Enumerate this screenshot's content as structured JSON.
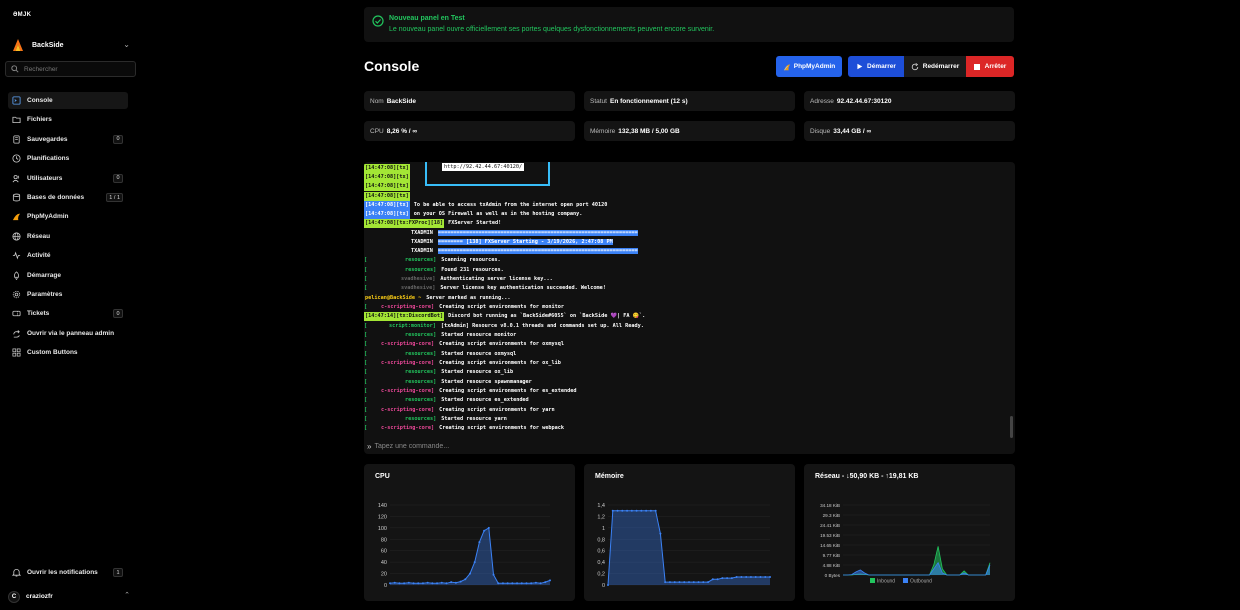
{
  "brand": {
    "logo_text": "ƏMJK"
  },
  "server_selector": {
    "name": "BackSide"
  },
  "search": {
    "placeholder": "Rechercher"
  },
  "nav": [
    {
      "label": "Console",
      "icon": "terminal-icon",
      "badge": ""
    },
    {
      "label": "Fichiers",
      "icon": "folder-icon",
      "badge": ""
    },
    {
      "label": "Sauvegardes",
      "icon": "archive-icon",
      "badge": "0"
    },
    {
      "label": "Planifications",
      "icon": "clock-icon",
      "badge": ""
    },
    {
      "label": "Utilisateurs",
      "icon": "users-icon",
      "badge": "0"
    },
    {
      "label": "Bases de données",
      "icon": "database-icon",
      "badge": "1 / 1"
    },
    {
      "label": "PhpMyAdmin",
      "icon": "phpmyadmin-icon",
      "badge": ""
    },
    {
      "label": "Réseau",
      "icon": "network-icon",
      "badge": ""
    },
    {
      "label": "Activité",
      "icon": "activity-icon",
      "badge": ""
    },
    {
      "label": "Démarrage",
      "icon": "rocket-icon",
      "badge": ""
    },
    {
      "label": "Paramètres",
      "icon": "gear-icon",
      "badge": ""
    },
    {
      "label": "Tickets",
      "icon": "ticket-icon",
      "badge": "0"
    },
    {
      "label": "Ouvrir via le panneau admin",
      "icon": "external-link-icon",
      "badge": ""
    },
    {
      "label": "Custom Buttons",
      "icon": "grid-icon",
      "badge": ""
    }
  ],
  "notifications": {
    "label": "Ouvrir les notifications",
    "badge": "1"
  },
  "user": {
    "initial": "C",
    "name": "craziozfr"
  },
  "banner": {
    "title": "Nouveau panel en Test",
    "message": "Le nouveau panel ouvre officiellement ses portes quelques dysfonctionnements peuvent encore survenir."
  },
  "page": {
    "title": "Console"
  },
  "actions": {
    "phpmyadmin": "PhpMyAdmin",
    "start": "Démarrer",
    "restart": "Redémarrer",
    "stop": "Arrêter"
  },
  "info": {
    "name_label": "Nom",
    "name_value": "BackSide",
    "status_label": "Statut",
    "status_value": "En fonctionnement (12 s)",
    "address_label": "Adresse",
    "address_value": "92.42.44.67:30120",
    "cpu_label": "CPU",
    "cpu_value": "8,26 % / ∞",
    "memory_label": "Mémoire",
    "memory_value": "132,38 MB / 5,00 GB",
    "disk_label": "Disque",
    "disk_value": "33,44 GB / ∞"
  },
  "console": {
    "url_box": "http://92.42.44.67:40120/",
    "command_placeholder": "Tapez une commande...",
    "lines": [
      {
        "prefix": "[14:47:08][tx]",
        "text": ""
      },
      {
        "prefix": "[14:47:08][tx]",
        "text": ""
      },
      {
        "prefix": "[14:47:08][tx]",
        "text": ""
      },
      {
        "prefix": "[14:47:08][tx]",
        "text": ""
      },
      {
        "prefix": "[14:47:08][tx]",
        "text": "To be able to access txAdmin from the internet open port 40120"
      },
      {
        "prefix": "[14:47:08][tx]",
        "text": "on your OS Firewall as well as in the hosting company."
      },
      {
        "prefix": "[14:47:08][tx:FXProc][18]",
        "text": "FXServer Started!"
      },
      {
        "prefix": "TXADMIN",
        "text": "================================================================"
      },
      {
        "prefix": "TXADMIN",
        "text": "======== [138] FXServer Starting - 3/19/2026, 2:47:08 PM"
      },
      {
        "prefix": "TXADMIN",
        "text": "================================================================"
      },
      {
        "prefix": "resources]",
        "text": "Scanning resources."
      },
      {
        "prefix": "resources]",
        "text": "Found 231 resources."
      },
      {
        "prefix": "svadhesive]",
        "text": "Authenticating server license key..."
      },
      {
        "prefix": "svadhesive]",
        "text": "Server license key authentication succeeded. Welcome!"
      },
      {
        "prefix": "pelican@BackSide ~",
        "text": "Server marked as running..."
      },
      {
        "prefix": "c-scripting-core]",
        "text": "Creating script environments for monitor"
      },
      {
        "prefix": "[14:47:14][tx:DiscordBot]",
        "text": "Discord bot running as `BackSide#6055` on `BackSide 💜| FA 😋`."
      },
      {
        "prefix": "script:monitor]",
        "text": "[txAdmin] Resource v8.0.1 threads and commands set up. All Ready."
      },
      {
        "prefix": "resources]",
        "text": "Started resource monitor"
      },
      {
        "prefix": "c-scripting-core]",
        "text": "Creating script environments for oxmysql"
      },
      {
        "prefix": "resources]",
        "text": "Started resource oxmysql"
      },
      {
        "prefix": "c-scripting-core]",
        "text": "Creating script environments for ox_lib"
      },
      {
        "prefix": "resources]",
        "text": "Started resource ox_lib"
      },
      {
        "prefix": "resources]",
        "text": "Started resource spawnmanager"
      },
      {
        "prefix": "c-scripting-core]",
        "text": "Creating script environments for es_extended"
      },
      {
        "prefix": "resources]",
        "text": "Started resource es_extended"
      },
      {
        "prefix": "c-scripting-core]",
        "text": "Creating script environments for yarn"
      },
      {
        "prefix": "resources]",
        "text": "Started resource yarn"
      },
      {
        "prefix": "c-scripting-core]",
        "text": "Creating script environments for webpack"
      }
    ]
  },
  "colors": {
    "accent_green": "#22c55e",
    "button_blue": "#2563eb",
    "button_red": "#dc2626",
    "chart_blue": "#3b82f6",
    "chart_green": "#22c55e",
    "log_green_bg": "#a3e635",
    "log_blue_bg": "#3b82f6"
  },
  "chart_data": [
    {
      "type": "area",
      "title": "CPU",
      "ylim": [
        0,
        140
      ],
      "yticks": [
        "140",
        "120",
        "100",
        "80",
        "60",
        "40",
        "20",
        "0"
      ],
      "series": [
        {
          "values": [
            3,
            4,
            3,
            3,
            4,
            3,
            3,
            3,
            4,
            3,
            3,
            4,
            3,
            5,
            4,
            6,
            10,
            20,
            40,
            75,
            95,
            100,
            18,
            3,
            3,
            3,
            3,
            3,
            3,
            3,
            3,
            4,
            3,
            5,
            8
          ]
        }
      ]
    },
    {
      "type": "area",
      "title": "Mémoire",
      "ylim": [
        0,
        1.4
      ],
      "yticks": [
        "1,4",
        "1,2",
        "1",
        "0,8",
        "0,6",
        "0,4",
        "0,2",
        "0"
      ],
      "series": [
        {
          "values": [
            0,
            1.3,
            1.3,
            1.3,
            1.3,
            1.3,
            1.3,
            1.3,
            1.3,
            1.3,
            1.3,
            0.9,
            0.05,
            0.05,
            0.05,
            0.05,
            0.05,
            0.05,
            0.05,
            0.05,
            0.05,
            0.05,
            0.1,
            0.1,
            0.12,
            0.12,
            0.12,
            0.14,
            0.14,
            0.14,
            0.14,
            0.14,
            0.14,
            0.14,
            0.14
          ]
        }
      ]
    },
    {
      "type": "area",
      "title": "Réseau - ↓50,90 KB - ↑19,81 KB",
      "ylim": [
        0,
        34.18
      ],
      "yticks": [
        "34.18 KiB",
        "29.3 KiB",
        "24.41 KiB",
        "19.53 KiB",
        "14.65 KiB",
        "9.77 KiB",
        "4.88 KiB",
        "0 Bytes"
      ],
      "legend": [
        "Inbound",
        "Outbound"
      ],
      "series": [
        {
          "name": "Inbound",
          "values": [
            0,
            0,
            0,
            0.3,
            0.5,
            0.3,
            0,
            0,
            0,
            0,
            0,
            0,
            0,
            0,
            0,
            0,
            0,
            0,
            0,
            0,
            0,
            5,
            14,
            3,
            0,
            0,
            0,
            0,
            2,
            0,
            0,
            0,
            0,
            0,
            6
          ]
        },
        {
          "name": "Outbound",
          "values": [
            0,
            0,
            0.2,
            1.5,
            2.5,
            1,
            0,
            0,
            0,
            0,
            0,
            0,
            0,
            0,
            0,
            0,
            0,
            0,
            0,
            0,
            0,
            3,
            6,
            1,
            0,
            0,
            0,
            0,
            1,
            0,
            0,
            0,
            0,
            0,
            5
          ]
        }
      ]
    }
  ]
}
